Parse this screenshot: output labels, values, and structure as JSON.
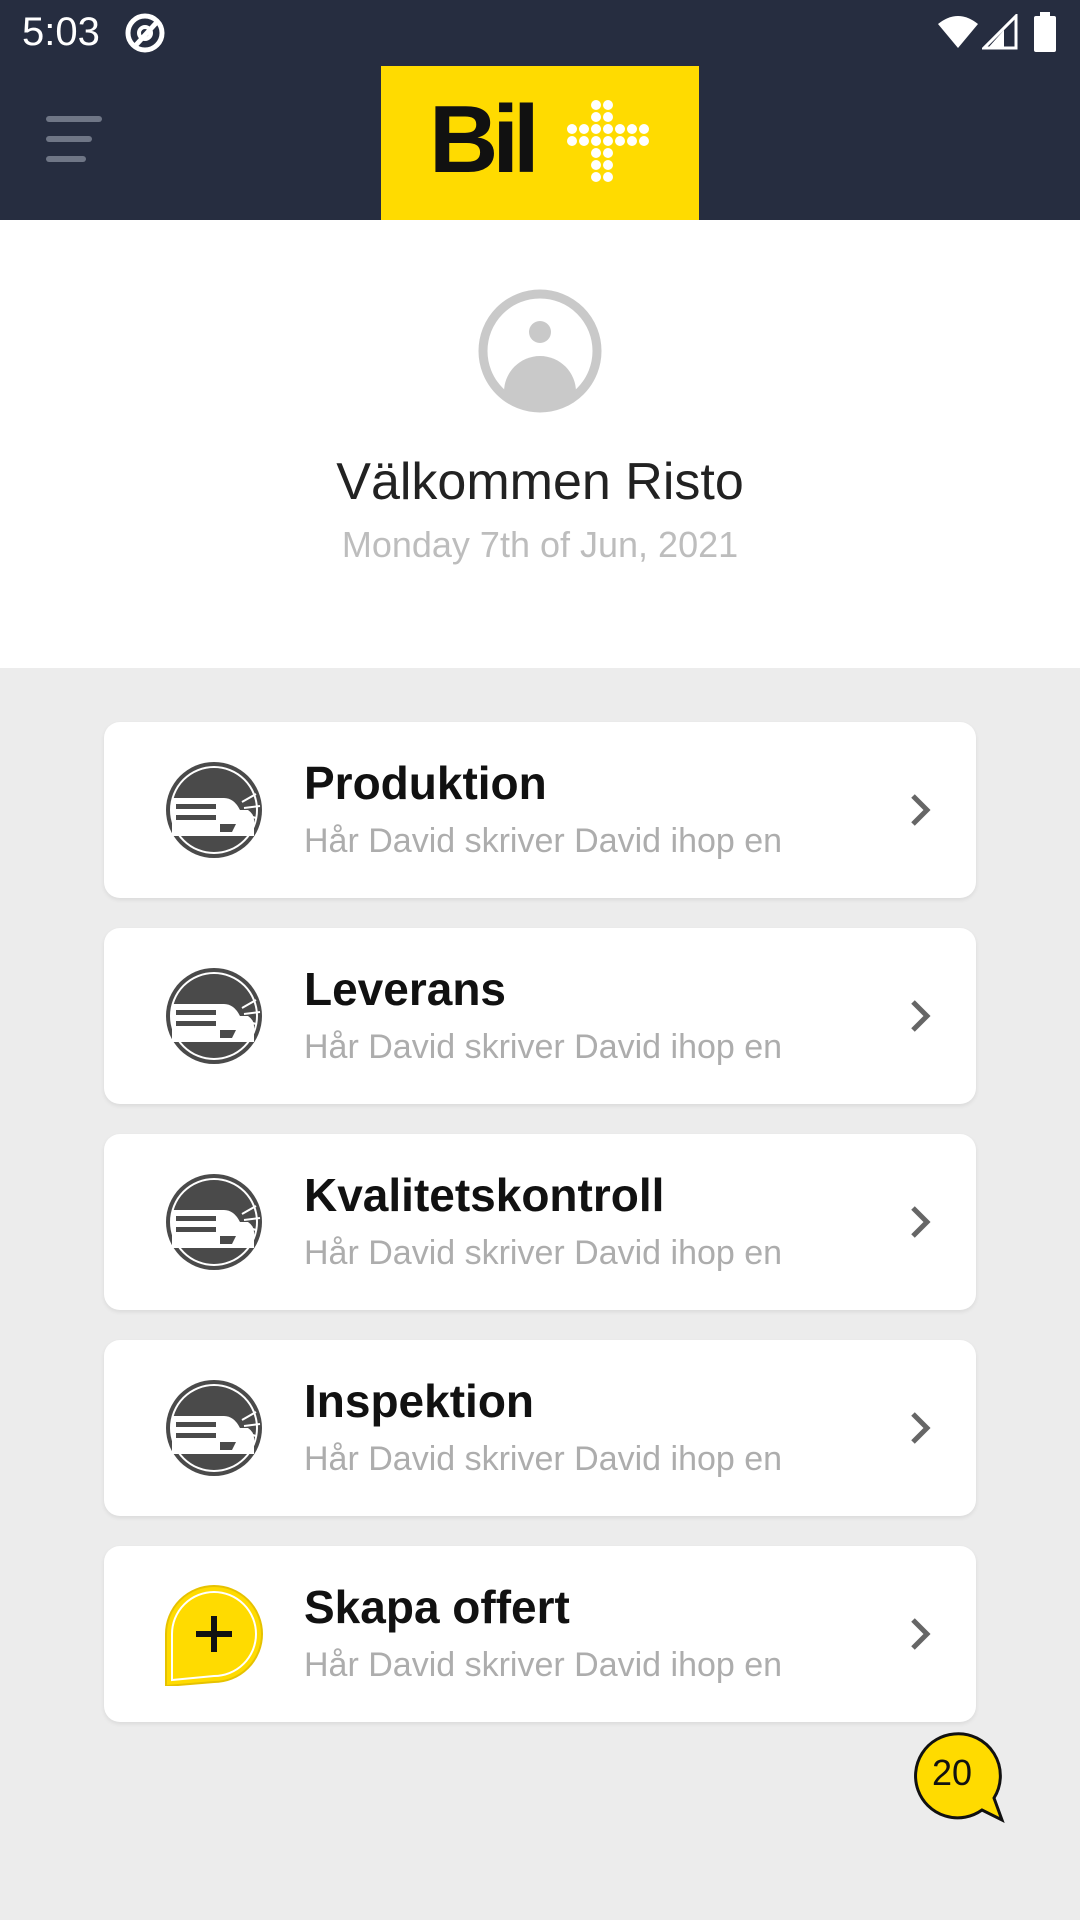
{
  "status_bar": {
    "time": "5:03"
  },
  "app_bar": {
    "logo_text": "Bil"
  },
  "welcome": {
    "title": "Välkommen Risto",
    "date": "Monday 7th of Jun, 2021"
  },
  "menu": [
    {
      "title": "Produktion",
      "subtitle": "Hår David skriver David ihop en",
      "icon": "car-icon"
    },
    {
      "title": "Leverans",
      "subtitle": "Hår David skriver David ihop en",
      "icon": "car-icon"
    },
    {
      "title": "Kvalitetskontroll",
      "subtitle": "Hår David skriver David ihop en",
      "icon": "car-icon"
    },
    {
      "title": "Inspektion",
      "subtitle": "Hår David skriver David ihop en",
      "icon": "car-icon"
    },
    {
      "title": "Skapa offert",
      "subtitle": "Hår David skriver David ihop en",
      "icon": "add-chat-icon"
    }
  ],
  "chat_badge": {
    "count": "20"
  },
  "colors": {
    "header_bg": "#262d40",
    "brand_yellow": "#ffdb00",
    "page_bg": "#ececec",
    "icon_gray": "#4a4a4a"
  }
}
